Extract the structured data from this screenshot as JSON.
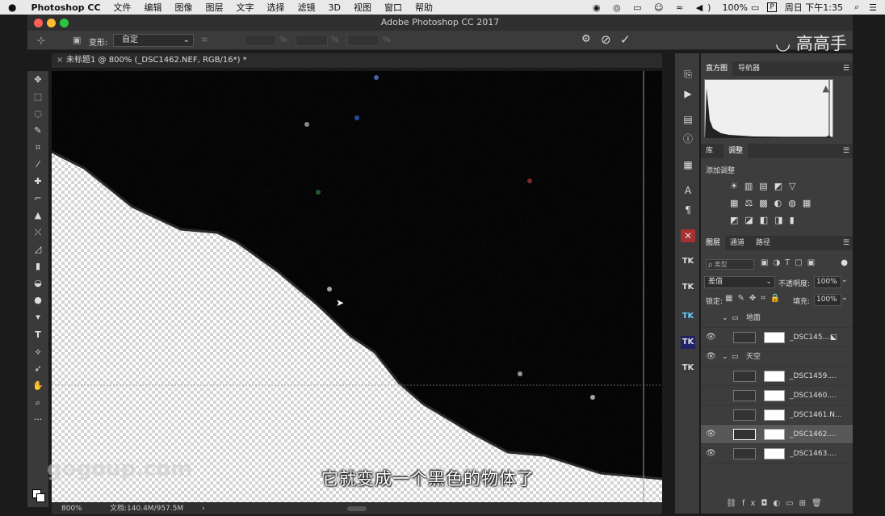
{
  "menubar": {
    "items": [
      "Photoshop CC",
      "文件",
      "编辑",
      "图像",
      "图层",
      "文字",
      "选择",
      "滤镜",
      "3D",
      "视图",
      "窗口",
      "帮助"
    ],
    "battery": "100%",
    "clock": "周日 下午1:35"
  },
  "window": {
    "title": "Adobe Photoshop CC 2017"
  },
  "options": {
    "transform_label": "变形:",
    "transform_value": "自定",
    "field_unit": "%"
  },
  "document": {
    "tab_title": "未标题1 @ 800% (_DSC1462.NEF, RGB/16*) *",
    "zoom": "800%",
    "doc_info": "文档:140.4M/957.5M"
  },
  "panels": {
    "top_tabs": [
      "直方图",
      "导航器"
    ],
    "adj_tabs": [
      "库",
      "调整"
    ],
    "adj_title": "添加调整",
    "layer_tabs": [
      "图层",
      "通道",
      "路径"
    ],
    "kind_label": "ρ 类型",
    "blend_mode": "差值",
    "opacity_label": "不透明度:",
    "opacity": "100%",
    "lock_label": "锁定:",
    "fill_label": "填充:",
    "fill": "100%"
  },
  "layers": [
    {
      "name": "地面",
      "type": "group"
    },
    {
      "name": "_DSC145...",
      "type": "layer"
    },
    {
      "name": "天空",
      "type": "group"
    },
    {
      "name": "_DSC1459....",
      "type": "layer"
    },
    {
      "name": "_DSC1460....",
      "type": "layer"
    },
    {
      "name": "_DSC1461.N...",
      "type": "layer"
    },
    {
      "name": "_DSC1462....",
      "type": "layer",
      "selected": true
    },
    {
      "name": "_DSC1463....",
      "type": "layer"
    }
  ],
  "subtitle": "它就变成一个黑色的物体了",
  "watermarks": {
    "left": "gogoup.com",
    "right": "高高手"
  },
  "colors": {
    "accent": "#2d8ceb",
    "panel": "#3d3d3d",
    "selected": "#585858"
  }
}
